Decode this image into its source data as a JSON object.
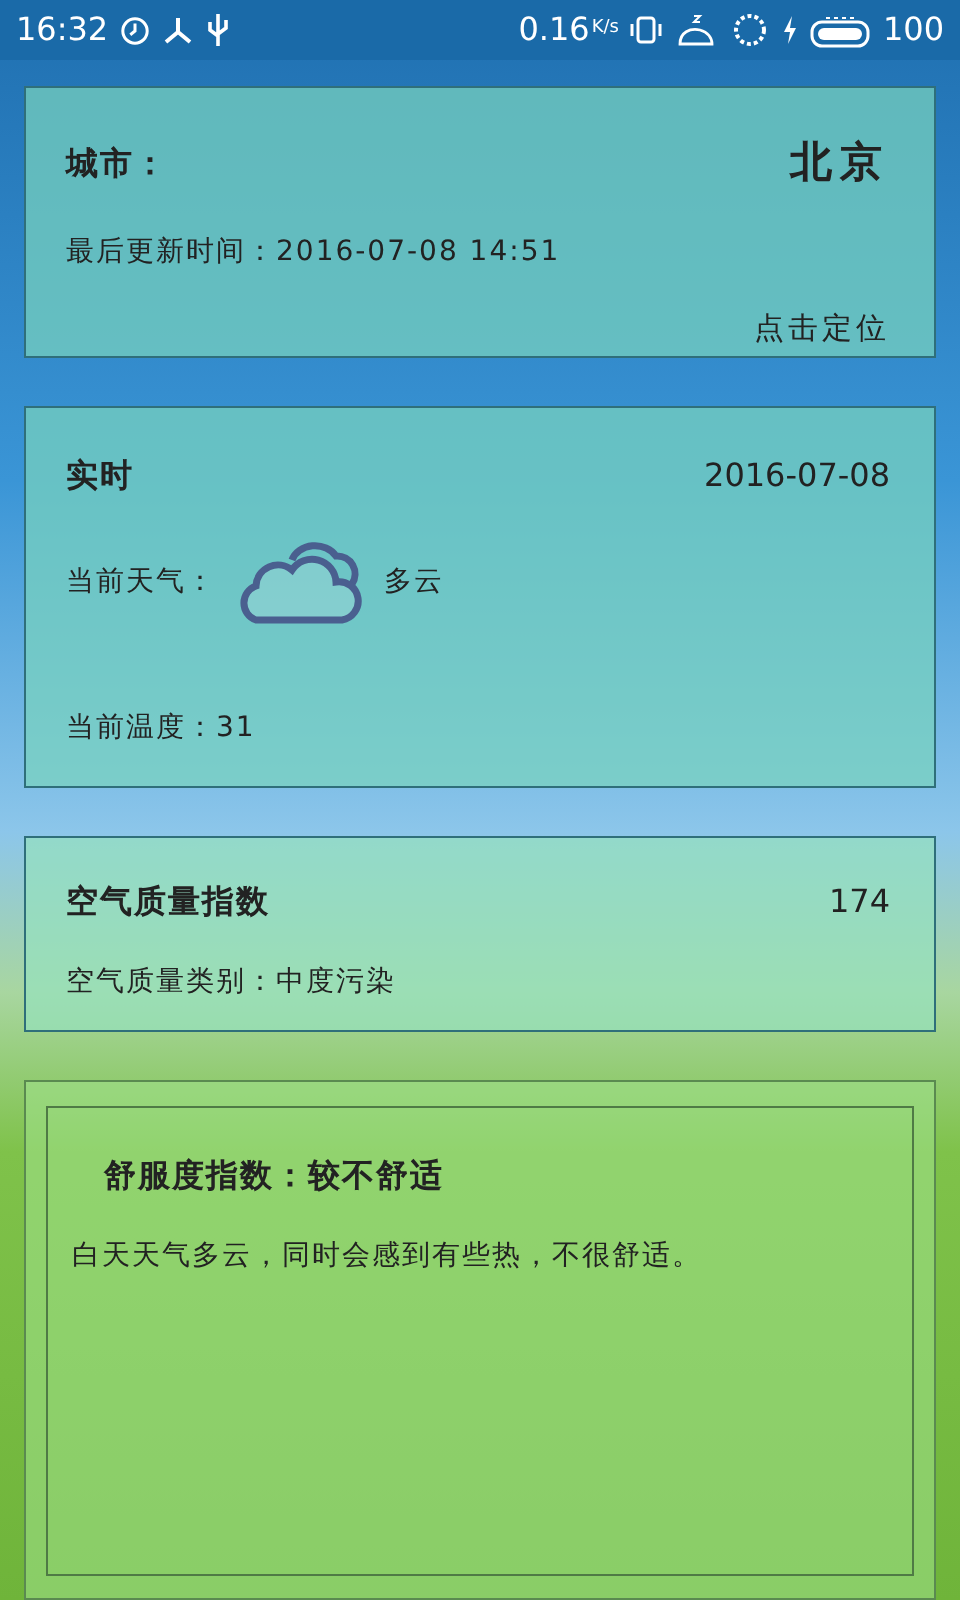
{
  "status_bar": {
    "time": "16:32",
    "net_speed": "0.16",
    "net_speed_unit": "K/s",
    "battery": "100"
  },
  "city_card": {
    "label": "城市：",
    "city": "北京",
    "updated": "最后更新时间：2016-07-08 14:51",
    "locate_link": "点击定位"
  },
  "realtime_card": {
    "title": "实时",
    "date": "2016-07-08",
    "weather_label": "当前天气：",
    "weather": "多云",
    "temperature": "当前温度：31"
  },
  "aqi_card": {
    "title": "空气质量指数",
    "value": "174",
    "category": "空气质量类别：中度污染"
  },
  "comfort_card": {
    "title": "舒服度指数：较不舒适",
    "description": "白天天气多云，同时会感到有些热，不很舒适。"
  }
}
